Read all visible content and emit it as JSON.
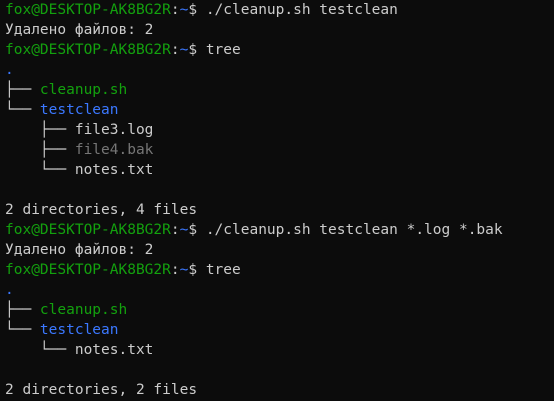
{
  "prompt": {
    "user_host": "fox@DESKTOP-AK8BG2R",
    "separator": ":",
    "path": "~",
    "symbol": "$"
  },
  "colors": {
    "background": "#0c0c0c",
    "foreground": "#cccccc",
    "green": "#13a10e",
    "blue": "#3b78ff",
    "gray": "#767676"
  },
  "session": {
    "cmd1": "./cleanup.sh testclean",
    "out1": "Удалено файлов: 2",
    "cmd2": "tree",
    "tree1": {
      "root": ".",
      "items": [
        {
          "branch": "├── ",
          "name": "cleanup.sh"
        },
        {
          "branch": "└── ",
          "name": "testclean"
        },
        {
          "branch": "    ├── ",
          "name": "file3.log"
        },
        {
          "branch": "    ├── ",
          "name": "file4.bak"
        },
        {
          "branch": "    └── ",
          "name": "notes.txt"
        }
      ],
      "summary": "2 directories, 4 files"
    },
    "cmd3": "./cleanup.sh testclean *.log *.bak",
    "out3": "Удалено файлов: 2",
    "cmd4": "tree",
    "tree2": {
      "root": ".",
      "items": [
        {
          "branch": "├── ",
          "name": "cleanup.sh"
        },
        {
          "branch": "└── ",
          "name": "testclean"
        },
        {
          "branch": "    └── ",
          "name": "notes.txt"
        }
      ],
      "summary": "2 directories, 2 files"
    }
  }
}
